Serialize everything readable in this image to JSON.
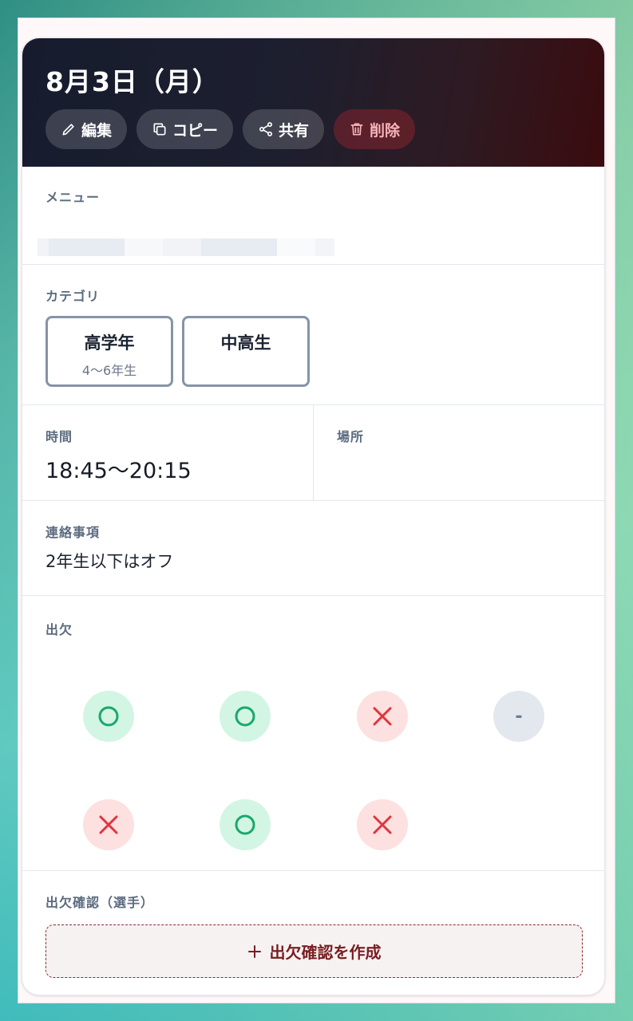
{
  "header": {
    "title": "8月3日（月）",
    "actions": {
      "edit": "編集",
      "copy": "コピー",
      "share": "共有",
      "delete": "削除"
    }
  },
  "menu": {
    "label": "メニュー"
  },
  "category": {
    "label": "カテゴリ",
    "items": [
      {
        "name": "高学年",
        "sub": "4〜6年生"
      },
      {
        "name": "中高生",
        "sub": ""
      }
    ]
  },
  "time": {
    "label": "時間",
    "value": "18:45〜20:15"
  },
  "place": {
    "label": "場所"
  },
  "notice": {
    "label": "連絡事項",
    "text": "2年生以下はオフ"
  },
  "attendance": {
    "label": "出欠",
    "marks": [
      "yes",
      "yes",
      "no",
      "none",
      "no",
      "yes",
      "no"
    ],
    "none_symbol": "-"
  },
  "confirm": {
    "label": "出欠確認（選手）",
    "create_button": "出欠確認を作成"
  },
  "colors": {
    "yes": "#1aa86b",
    "no": "#e0353d",
    "accent": "#7a1e22"
  }
}
